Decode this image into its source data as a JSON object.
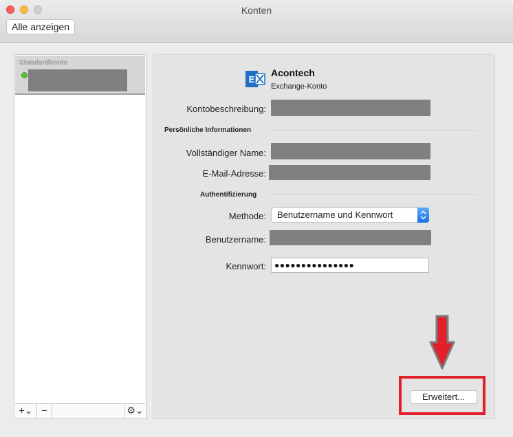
{
  "window": {
    "title": "Konten"
  },
  "toolbar": {
    "show_all": "Alle anzeigen"
  },
  "sidebar": {
    "group_label": "Standardkonto",
    "footer": {
      "add": "+⌄",
      "remove": "−",
      "gear": "⚙⌄"
    }
  },
  "account": {
    "name": "Acontech",
    "type": "Exchange-Konto",
    "description_label": "Kontobeschreibung:",
    "personal_section": "Persönliche Informationen",
    "fullname_label": "Vollständiger Name:",
    "email_label": "E-Mail-Adresse:",
    "auth_section": "Authentifizierung",
    "method_label": "Methode:",
    "method_value": "Benutzername und Kennwort",
    "username_label": "Benutzername:",
    "password_label": "Kennwort:",
    "password_value": "●●●●●●●●●●●●●●●",
    "advanced_button": "Erweitert..."
  },
  "colors": {
    "highlight": "#e2202a",
    "exchange_blue": "#1f6fc5",
    "status_online": "#5bc236"
  },
  "icons": {
    "logo": "exchange-logo-icon",
    "status": "online-status-icon",
    "gear": "gear-icon",
    "annotation": "down-arrow-icon"
  }
}
